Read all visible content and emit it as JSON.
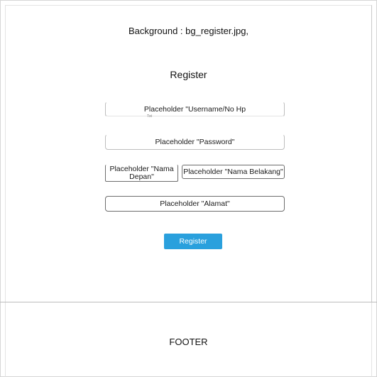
{
  "background_note": "Background : bg_register.jpg,",
  "form": {
    "title": "Register",
    "username_placeholder": "Placeholder \"Username/No Hp",
    "username_tiny": "Txt",
    "password_placeholder": "Placeholder \"Password\"",
    "first_name_placeholder": "Placeholder \"Nama Depan\"",
    "last_name_placeholder": "Placeholder \"Nama Belakang\"",
    "address_placeholder": "Placeholder \"Alamat\"",
    "submit_label": "Register"
  },
  "footer": {
    "text": "FOOTER"
  },
  "colors": {
    "button_bg": "#2aa0dd",
    "button_text": "#ffffff",
    "border": "#bdbdbd"
  }
}
